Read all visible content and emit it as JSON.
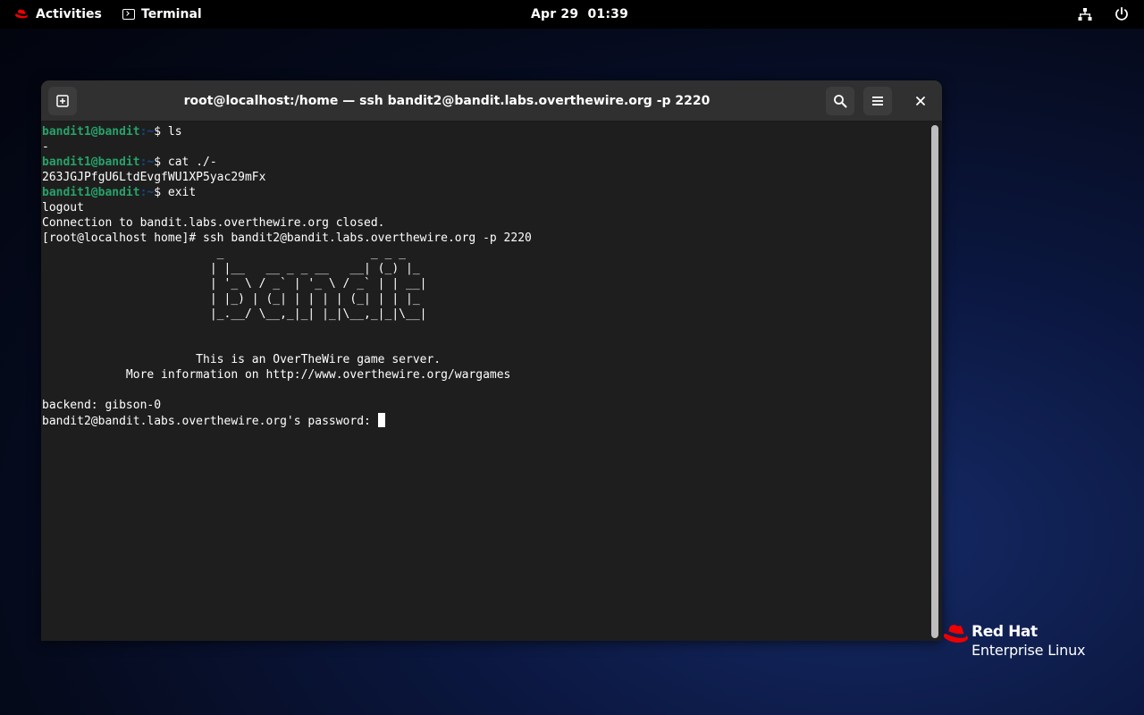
{
  "topbar": {
    "activities_label": "Activities",
    "app_label": "Terminal",
    "clock": "Apr 29  01:39"
  },
  "window": {
    "title": "root@localhost:/home — ssh bandit2@bandit.labs.overthewire.org -p 2220"
  },
  "terminal": {
    "lines": [
      {
        "user": "bandit1@bandit",
        "path": ":~",
        "rest": "$ ls"
      },
      {
        "text": "-"
      },
      {
        "user": "bandit1@bandit",
        "path": ":~",
        "rest": "$ cat ./-"
      },
      {
        "text": "263JGJPfgU6LtdEvgfWU1XP5yac29mFx"
      },
      {
        "user": "bandit1@bandit",
        "path": ":~",
        "rest": "$ exit"
      },
      {
        "text": "logout"
      },
      {
        "text": "Connection to bandit.labs.overthewire.org closed."
      },
      {
        "text": "[root@localhost home]# ssh bandit2@bandit.labs.overthewire.org -p 2220"
      },
      {
        "text": "                         _                     _ _ _"
      },
      {
        "text": "                        | |__   __ _ _ __   __| (_) |_"
      },
      {
        "text": "                        | '_ \\ / _` | '_ \\ / _` | | __|"
      },
      {
        "text": "                        | |_) | (_| | | | | (_| | | |_"
      },
      {
        "text": "                        |_.__/ \\__,_|_| |_|\\__,_|_|\\__|"
      },
      {
        "text": ""
      },
      {
        "text": ""
      },
      {
        "text": "                      This is an OverTheWire game server."
      },
      {
        "text": "            More information on http://www.overthewire.org/wargames"
      },
      {
        "text": ""
      },
      {
        "text": "backend: gibson-0"
      },
      {
        "text": "bandit2@bandit.labs.overthewire.org's password: ",
        "cursor": true
      }
    ]
  },
  "brand": {
    "line1": "Red Hat",
    "line2": "Enterprise Linux"
  },
  "colors": {
    "prompt_user": "#26a269",
    "prompt_path": "#12488b",
    "terminal_bg": "#1e1e1e",
    "headerbar_bg": "#303030",
    "redhat_red": "#ee0000"
  },
  "icons": {
    "activities": "redhat-icon",
    "app": "terminal-icon",
    "new_tab": "new-tab-icon",
    "search": "search-icon",
    "menu": "hamburger-menu-icon",
    "close": "close-icon",
    "network": "network-icon",
    "power": "power-icon"
  }
}
